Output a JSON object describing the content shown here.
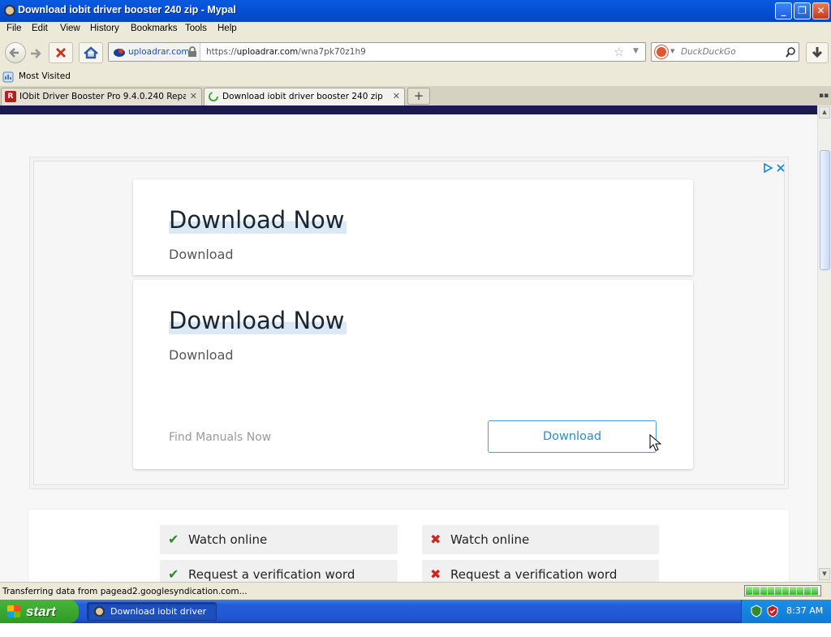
{
  "window": {
    "title": "Download iobit driver booster 240 zip - Mypal"
  },
  "menu": [
    "File",
    "Edit",
    "View",
    "History",
    "Bookmarks",
    "Tools",
    "Help"
  ],
  "nav": {
    "identity_domain": "uploadrar.com",
    "url_prefix": "https://",
    "url_host": "uploadrar.com",
    "url_path": "/wna7pk70z1h9",
    "search_placeholder": "DuckDuckGo"
  },
  "bookmarks": {
    "most_visited": "Most Visited"
  },
  "tabs": [
    {
      "label": "IObit Driver Booster Pro 9.4.0.240 Repa..."
    },
    {
      "label": "Download iobit driver booster 240 zip"
    }
  ],
  "ad": {
    "card1": {
      "headline": "Download Now",
      "sub": "Download"
    },
    "card2": {
      "headline": "Download Now",
      "sub": "Download",
      "advertiser": "Find Manuals Now",
      "button": "Download"
    }
  },
  "features": {
    "left": [
      {
        "label": "Watch online",
        "ok": true
      },
      {
        "label": "Request a verification word",
        "ok": true
      }
    ],
    "right": [
      {
        "label": "Watch online",
        "ok": false
      },
      {
        "label": "Request a verification word",
        "ok": false
      }
    ]
  },
  "status": {
    "text": "Transferring data from pagead2.googlesyndication.com...",
    "progress": 1.0
  },
  "taskbar": {
    "start": "start",
    "item": "Download iobit driver ...",
    "clock": "8:37 AM"
  },
  "colors": {
    "titlebar": "#0551d6",
    "ok": "#2b8a2b",
    "bad": "#d62020",
    "accent": "#2a8ccb"
  }
}
